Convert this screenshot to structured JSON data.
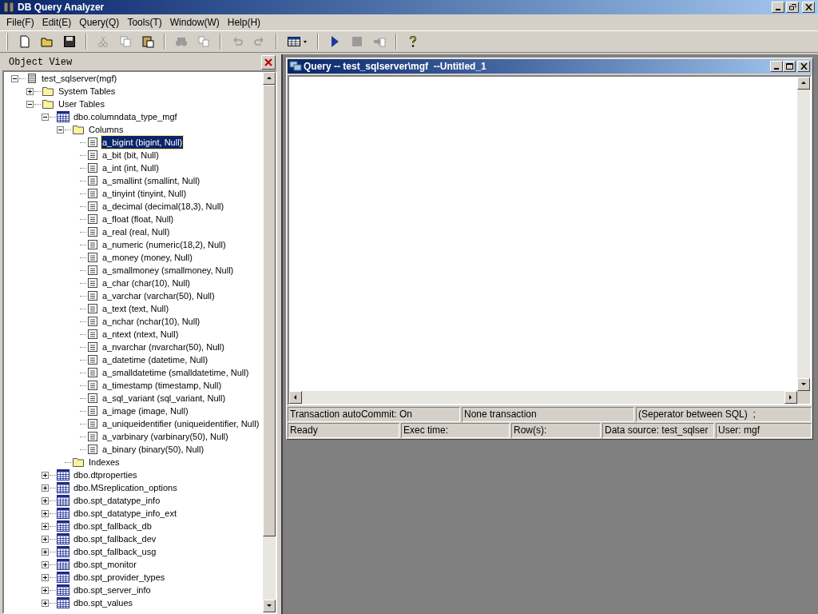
{
  "window": {
    "title": "DB Query Analyzer"
  },
  "menu": [
    "File(F)",
    "Edit(E)",
    "Query(Q)",
    "Tools(T)",
    "Window(W)",
    "Help(H)"
  ],
  "toolbar": [
    {
      "kind": "new",
      "disabled": false
    },
    {
      "kind": "open",
      "disabled": false
    },
    {
      "kind": "save",
      "disabled": false
    },
    {
      "kind": "sep"
    },
    {
      "kind": "cut",
      "disabled": true
    },
    {
      "kind": "copy",
      "disabled": true
    },
    {
      "kind": "paste",
      "disabled": false
    },
    {
      "kind": "sep"
    },
    {
      "kind": "find",
      "disabled": true
    },
    {
      "kind": "replace",
      "disabled": true
    },
    {
      "kind": "sep"
    },
    {
      "kind": "undo",
      "disabled": true
    },
    {
      "kind": "redo",
      "disabled": true
    },
    {
      "kind": "sep"
    },
    {
      "kind": "grid",
      "disabled": false
    },
    {
      "kind": "sep"
    },
    {
      "kind": "run",
      "disabled": false
    },
    {
      "kind": "stop",
      "disabled": true
    },
    {
      "kind": "step",
      "disabled": true
    },
    {
      "kind": "sep"
    },
    {
      "kind": "help",
      "disabled": false
    }
  ],
  "object_view": {
    "title": "Object View",
    "tree": [
      {
        "label": "test_sqlserver(mgf)",
        "kind": "server",
        "expanded": true,
        "selected": false,
        "children": [
          {
            "label": "System Tables",
            "kind": "folder",
            "expanded": false,
            "selected": false
          },
          {
            "label": "User Tables",
            "kind": "folder",
            "expanded": true,
            "selected": false,
            "children": [
              {
                "label": "dbo.columndata_type_mgf",
                "kind": "table",
                "expanded": true,
                "selected": false,
                "children": [
                  {
                    "label": "Columns",
                    "kind": "folder",
                    "expanded": true,
                    "selected": false,
                    "children": [
                      {
                        "label": "a_bigint (bigint, Null)",
                        "kind": "column",
                        "selected": true
                      },
                      {
                        "label": "a_bit (bit, Null)",
                        "kind": "column",
                        "selected": false
                      },
                      {
                        "label": "a_int (int, Null)",
                        "kind": "column",
                        "selected": false
                      },
                      {
                        "label": "a_smallint (smallint, Null)",
                        "kind": "column",
                        "selected": false
                      },
                      {
                        "label": "a_tinyint (tinyint, Null)",
                        "kind": "column",
                        "selected": false
                      },
                      {
                        "label": "a_decimal (decimal(18,3), Null)",
                        "kind": "column",
                        "selected": false
                      },
                      {
                        "label": "a_float (float, Null)",
                        "kind": "column",
                        "selected": false
                      },
                      {
                        "label": "a_real (real, Null)",
                        "kind": "column",
                        "selected": false
                      },
                      {
                        "label": "a_numeric (numeric(18,2), Null)",
                        "kind": "column",
                        "selected": false
                      },
                      {
                        "label": "a_money (money, Null)",
                        "kind": "column",
                        "selected": false
                      },
                      {
                        "label": "a_smallmoney (smallmoney, Null)",
                        "kind": "column",
                        "selected": false
                      },
                      {
                        "label": "a_char (char(10), Null)",
                        "kind": "column",
                        "selected": false
                      },
                      {
                        "label": "a_varchar (varchar(50), Null)",
                        "kind": "column",
                        "selected": false
                      },
                      {
                        "label": "a_text (text, Null)",
                        "kind": "column",
                        "selected": false
                      },
                      {
                        "label": "a_nchar (nchar(10), Null)",
                        "kind": "column",
                        "selected": false
                      },
                      {
                        "label": "a_ntext (ntext, Null)",
                        "kind": "column",
                        "selected": false
                      },
                      {
                        "label": "a_nvarchar (nvarchar(50), Null)",
                        "kind": "column",
                        "selected": false
                      },
                      {
                        "label": "a_datetime (datetime, Null)",
                        "kind": "column",
                        "selected": false
                      },
                      {
                        "label": "a_smalldatetime (smalldatetime, Null)",
                        "kind": "column",
                        "selected": false
                      },
                      {
                        "label": "a_timestamp (timestamp, Null)",
                        "kind": "column",
                        "selected": false
                      },
                      {
                        "label": "a_sql_variant (sql_variant, Null)",
                        "kind": "column",
                        "selected": false
                      },
                      {
                        "label": "a_image (image, Null)",
                        "kind": "column",
                        "selected": false
                      },
                      {
                        "label": "a_uniqueidentifier (uniqueidentifier, Null)",
                        "kind": "column",
                        "selected": false
                      },
                      {
                        "label": "a_varbinary (varbinary(50), Null)",
                        "kind": "column",
                        "selected": false
                      },
                      {
                        "label": "a_binary (binary(50), Null)",
                        "kind": "column",
                        "selected": false
                      }
                    ]
                  },
                  {
                    "label": "Indexes",
                    "kind": "folder",
                    "selected": false
                  }
                ]
              },
              {
                "label": "dbo.dtproperties",
                "kind": "table",
                "expanded": false,
                "selected": false
              },
              {
                "label": "dbo.MSreplication_options",
                "kind": "table",
                "expanded": false,
                "selected": false
              },
              {
                "label": "dbo.spt_datatype_info",
                "kind": "table",
                "expanded": false,
                "selected": false
              },
              {
                "label": "dbo.spt_datatype_info_ext",
                "kind": "table",
                "expanded": false,
                "selected": false
              },
              {
                "label": "dbo.spt_fallback_db",
                "kind": "table",
                "expanded": false,
                "selected": false
              },
              {
                "label": "dbo.spt_fallback_dev",
                "kind": "table",
                "expanded": false,
                "selected": false
              },
              {
                "label": "dbo.spt_fallback_usg",
                "kind": "table",
                "expanded": false,
                "selected": false
              },
              {
                "label": "dbo.spt_monitor",
                "kind": "table",
                "expanded": false,
                "selected": false
              },
              {
                "label": "dbo.spt_provider_types",
                "kind": "table",
                "expanded": false,
                "selected": false
              },
              {
                "label": "dbo.spt_server_info",
                "kind": "table",
                "expanded": false,
                "selected": false
              },
              {
                "label": "dbo.spt_values",
                "kind": "table",
                "expanded": false,
                "selected": false
              }
            ]
          }
        ]
      }
    ]
  },
  "query_window": {
    "title": "Query -- test_sqlserver\\mgf  --Untitled_1",
    "status_top": [
      "Transaction autoCommit: On",
      "None transaction",
      "(Seperator between SQL)  ;"
    ],
    "status_bottom": [
      "Ready",
      "Exec time:",
      "Row(s):",
      "Data source: test_sqlser",
      "User: mgf"
    ]
  }
}
